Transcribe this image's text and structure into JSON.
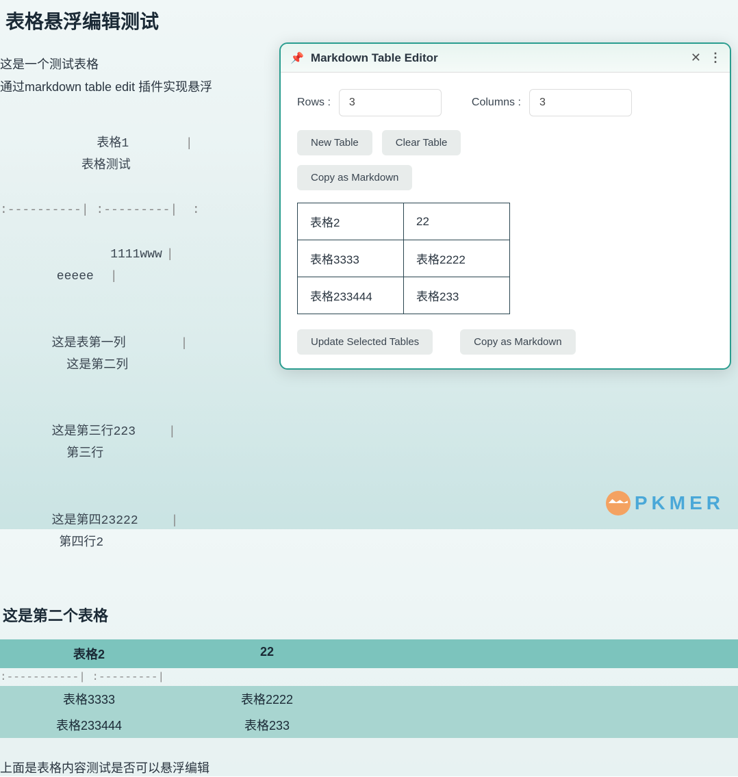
{
  "page": {
    "title": "表格悬浮编辑测试",
    "desc1": "这是一个测试表格",
    "desc2": "通过markdown table  edit 插件实现悬浮",
    "second_heading": "这是第二个表格",
    "footer": "上面是表格内容测试是否可以悬浮编辑"
  },
  "md_table1": {
    "headers": [
      "表格1",
      "表格测试"
    ],
    "sep_line": ":----------| :---------|  :",
    "rows": [
      [
        "1111www",
        "eeeee"
      ],
      [
        "这是表第一列",
        "这是第二列"
      ],
      [
        "这是第三行223",
        "第三行"
      ],
      [
        "这是第四23222",
        "第四行2"
      ]
    ]
  },
  "styled_table": {
    "headers": [
      "表格2",
      "22"
    ],
    "sep_line": ":-----------| :---------|",
    "rows": [
      [
        "表格3333",
        "表格2222"
      ],
      [
        "表格233444",
        "表格233"
      ]
    ]
  },
  "popup": {
    "title": "Markdown Table Editor",
    "rows_label": "Rows :",
    "rows_value": "3",
    "cols_label": "Columns :",
    "cols_value": "3",
    "new_table_btn": "New Table",
    "clear_table_btn": "Clear Table",
    "copy_md_btn": "Copy as Markdown",
    "update_btn": "Update Selected Tables",
    "copy_md_btn2": "Copy as Markdown",
    "cells": [
      [
        "表格2",
        "22"
      ],
      [
        "表格3333",
        "表格2222"
      ],
      [
        "表格233444",
        "表格233"
      ]
    ]
  },
  "logo": {
    "text": "PKMER"
  }
}
